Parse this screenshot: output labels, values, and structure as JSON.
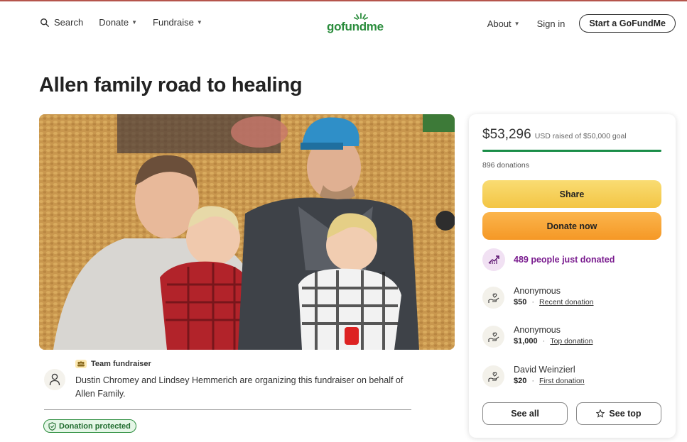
{
  "header": {
    "search_label": "Search",
    "donate_label": "Donate",
    "fundraise_label": "Fundraise",
    "logo_text": "gofundme",
    "about_label": "About",
    "signin_label": "Sign in",
    "start_label": "Start a GoFundMe",
    "brand_color": "#2a8c3c"
  },
  "campaign": {
    "title": "Allen family road to healing",
    "team_label": "Team fundraiser",
    "organizer_text": "Dustin Chromey and Lindsey Hemmerich are organizing this fundraiser on behalf of Allen Family.",
    "protected_label": "Donation protected"
  },
  "card": {
    "amount": "$53,296",
    "goal_text": "USD raised of $50,000 goal",
    "progress_fraction": 1.0,
    "donations_count": "896 donations",
    "share_label": "Share",
    "donate_label": "Donate now",
    "trend_text": "489 people just donated",
    "donors": [
      {
        "name": "Anonymous",
        "amount": "$50",
        "tag": "Recent donation"
      },
      {
        "name": "Anonymous",
        "amount": "$1,000",
        "tag": "Top donation"
      },
      {
        "name": "David Weinzierl",
        "amount": "$20",
        "tag": "First donation"
      }
    ],
    "see_all_label": "See all",
    "see_top_label": "See top",
    "accent_colors": {
      "share": "#f3c544",
      "donate": "#f59826",
      "trend": "#7a1c8f",
      "progress": "#1a8d48"
    }
  }
}
